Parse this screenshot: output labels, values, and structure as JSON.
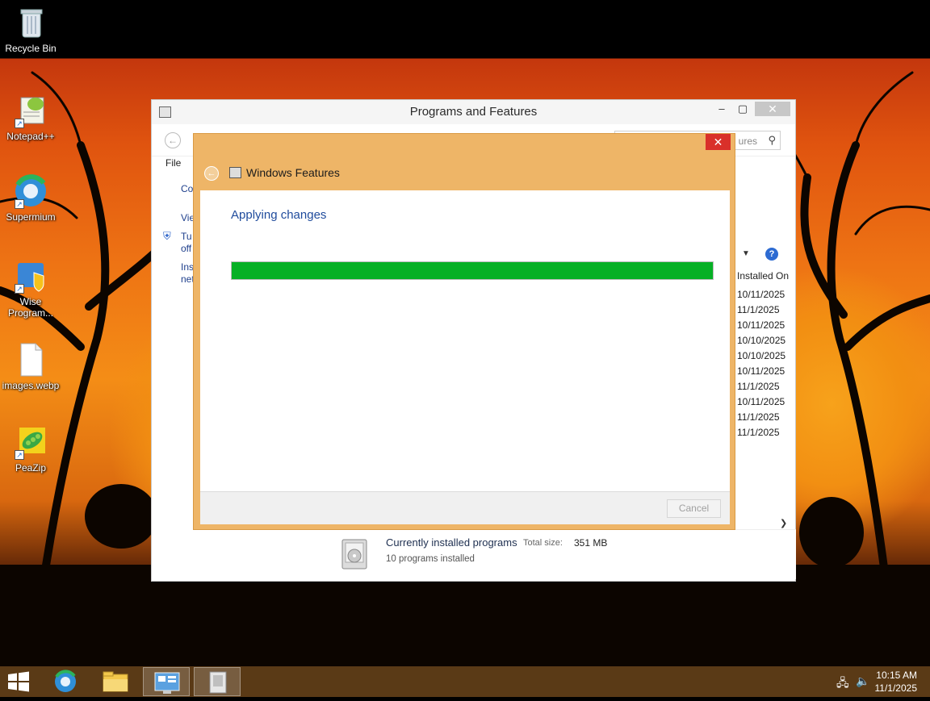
{
  "desktop": {
    "icons": [
      {
        "label": "Recycle Bin"
      },
      {
        "label": "Notepad++"
      },
      {
        "label": "Supermium"
      },
      {
        "label": "Wise Program..."
      },
      {
        "label": "images.webp"
      },
      {
        "label": "PeaZip"
      }
    ]
  },
  "programs_window": {
    "title": "Programs and Features",
    "search_placeholder": "ures",
    "menu": {
      "file": "File"
    },
    "left_pane": [
      "Co",
      "Vie",
      "Tu",
      "off",
      "Ins",
      "net"
    ],
    "column_installed_on": "Installed On",
    "installed_dates": [
      "10/11/2025",
      "11/1/2025",
      "10/11/2025",
      "10/10/2025",
      "10/10/2025",
      "10/11/2025",
      "11/1/2025",
      "10/11/2025",
      "11/1/2025",
      "11/1/2025"
    ],
    "details": {
      "title": "Currently installed programs",
      "total_size_label": "Total size:",
      "total_size_value": "351 MB",
      "count": "10 programs installed"
    }
  },
  "features_dialog": {
    "title": "Windows Features",
    "heading": "Applying changes",
    "progress": 1.0,
    "cancel_label": "Cancel"
  },
  "taskbar": {
    "clock_time": "10:15 AM",
    "clock_date": "11/1/2025"
  },
  "colors": {
    "dialog_frame": "#eeb567",
    "progress_fill": "#06b025",
    "taskbar": "#5a3a16",
    "close_red": "#d9302a"
  }
}
